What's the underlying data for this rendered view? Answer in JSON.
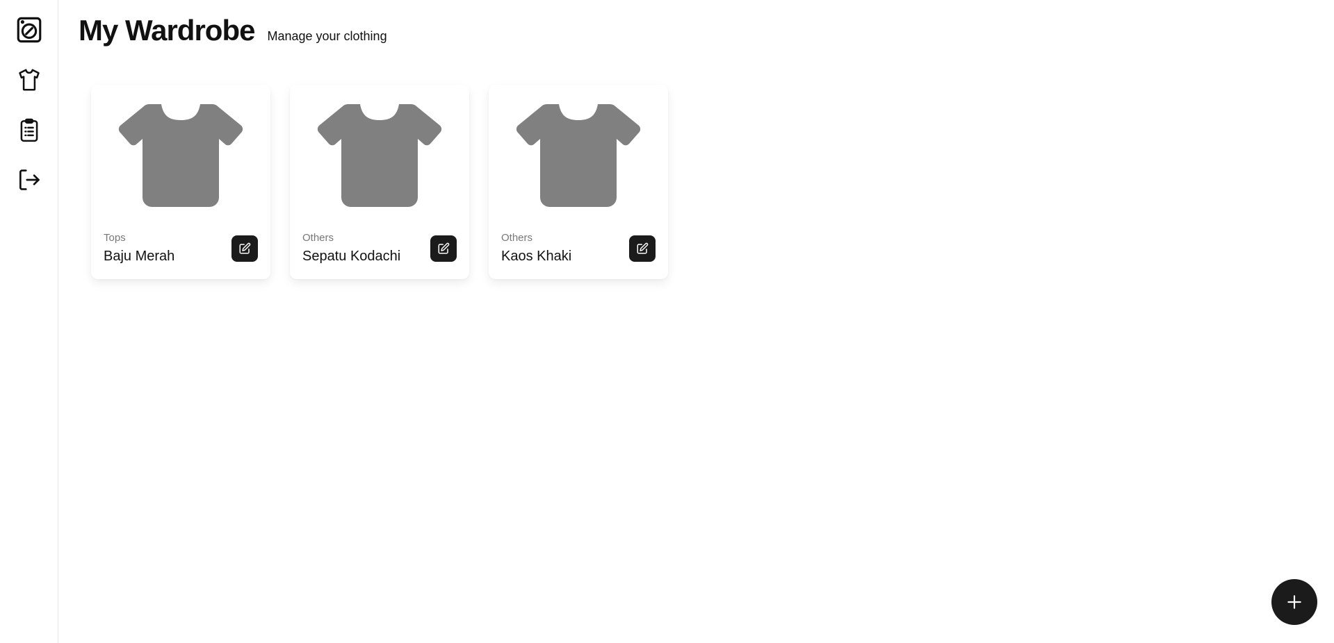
{
  "header": {
    "title": "My Wardrobe",
    "subtitle": "Manage your clothing"
  },
  "sidebar": {
    "items": [
      {
        "icon": "washing-machine-icon"
      },
      {
        "icon": "shirt-icon"
      },
      {
        "icon": "clipboard-list-icon"
      },
      {
        "icon": "logout-icon"
      }
    ]
  },
  "cards": [
    {
      "category": "Tops",
      "name": "Baju Merah",
      "image_icon": "shirt-icon"
    },
    {
      "category": "Others",
      "name": "Sepatu Kodachi",
      "image_icon": "shirt-icon"
    },
    {
      "category": "Others",
      "name": "Kaos Khaki",
      "image_icon": "shirt-icon"
    }
  ],
  "fab": {
    "icon": "plus-icon"
  },
  "colors": {
    "accent": "#1b1b1b",
    "placeholder_gray": "#808080",
    "muted_text": "#777777"
  }
}
